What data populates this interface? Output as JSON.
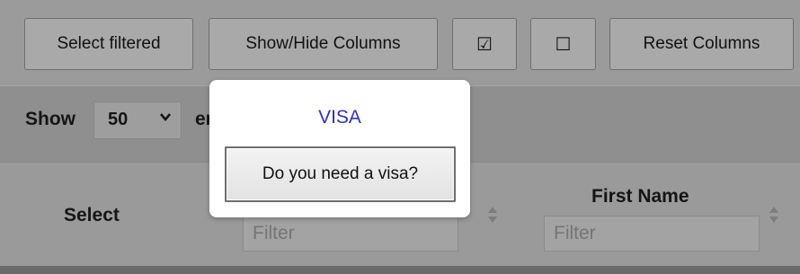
{
  "toolbar": {
    "select_filtered_label": "Select filtered",
    "show_hide_columns_label": "Show/Hide Columns",
    "check_all_label": "☑",
    "uncheck_all_label": "☐",
    "reset_columns_label": "Reset Columns"
  },
  "length": {
    "show_label": "Show",
    "selected_value": "50",
    "entries_label": "entries"
  },
  "columns": [
    {
      "title": "Select"
    },
    {
      "title": "",
      "filter_placeholder": "Filter"
    },
    {
      "title": "First Name",
      "filter_placeholder": "Filter"
    }
  ],
  "popup": {
    "title": "VISA",
    "button_label": "Do you need a visa?"
  },
  "colors": {
    "popup_title": "#2f2fbf",
    "overlay": "#9a9a9a"
  }
}
